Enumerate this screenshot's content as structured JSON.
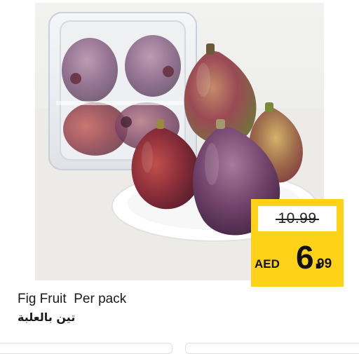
{
  "product": {
    "title": "Fig Fruit  Per pack",
    "subtitle_ar": "تين بالعلبة",
    "image_alt": "figs-photo"
  },
  "price": {
    "old": "10.99",
    "currency": "AED",
    "new_int": "6.",
    "new_dec": "99"
  },
  "colors": {
    "badge": "#ffd21a",
    "fig_purple": "#6e3a5e",
    "fig_green": "#8a9a45"
  }
}
